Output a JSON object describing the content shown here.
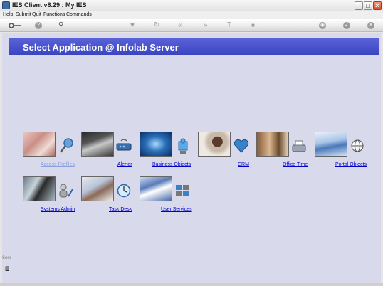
{
  "window": {
    "title": "IES Client v8.29 : My IES",
    "minimize": "_",
    "maximize": "□",
    "close": "✕"
  },
  "menu": [
    "Help",
    "Submit",
    "Quit",
    "Functions",
    "Commands"
  ],
  "toolbar": {
    "info": "?",
    "search": "⚲",
    "heart": "♥",
    "refresh": "↻",
    "back": "«",
    "forward": "»",
    "text": "T",
    "stop": "■",
    "globe": "◉",
    "ok": "✓",
    "exit": "✕"
  },
  "banner": {
    "title": "Select Application @  Infolab Server"
  },
  "apps": [
    {
      "label": "Access Profiles",
      "icon": "key-icon"
    },
    {
      "label": "Alerter",
      "icon": "router-icon"
    },
    {
      "label": "Business Objects",
      "icon": "puzzle-icon"
    },
    {
      "label": "CRM",
      "icon": "heart-icon"
    },
    {
      "label": "Office Time",
      "icon": "typewriter-icon"
    },
    {
      "label": "Portal Objects",
      "icon": "globe-icon"
    },
    {
      "label": "Systems Admin",
      "icon": "admin-user-icon"
    },
    {
      "label": "Task Desk",
      "icon": "clock-icon"
    },
    {
      "label": "User Services",
      "icon": "user-services-icon"
    }
  ],
  "side": {
    "top": "Sess",
    "bottom": "E"
  },
  "colors": {
    "banner": "#4a52cc",
    "workspace": "#d9d9ec",
    "link": "#0000cc"
  }
}
